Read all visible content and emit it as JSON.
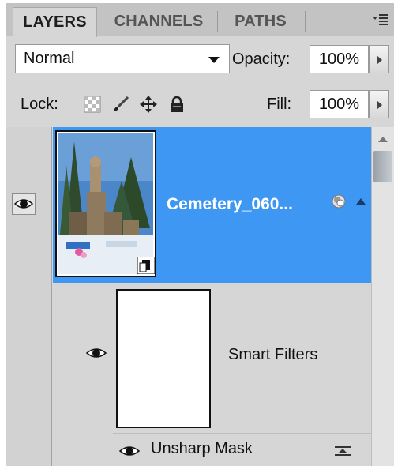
{
  "tabs": [
    {
      "label": "LAYERS",
      "active": true
    },
    {
      "label": "CHANNELS",
      "active": false
    },
    {
      "label": "PATHS",
      "active": false
    }
  ],
  "options": {
    "blend_mode": "Normal",
    "opacity_label": "Opacity:",
    "opacity_value": "100%",
    "lock_label": "Lock:",
    "fill_label": "Fill:",
    "fill_value": "100%"
  },
  "layers": {
    "main": {
      "name": "Cemetery_060...",
      "selected": true,
      "visible": true
    },
    "smart_filters_label": "Smart Filters",
    "filter": {
      "name": "Unsharp Mask",
      "visible": true
    }
  },
  "colors": {
    "selection": "#3f97f4",
    "panel": "#d6d6d6"
  },
  "icons": [
    "panel-menu-icon",
    "lock-transparent-icon",
    "lock-brush-icon",
    "lock-move-icon",
    "lock-all-icon",
    "eye-icon",
    "smart-object-icon",
    "blending-options-icon"
  ]
}
